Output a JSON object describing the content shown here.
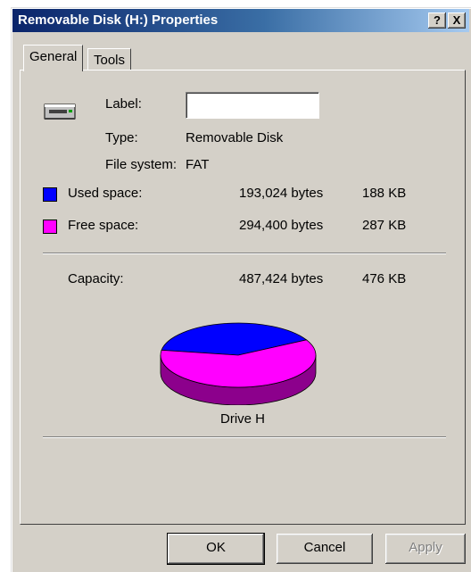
{
  "window": {
    "title": "Removable Disk (H:) Properties",
    "help_glyph": "?",
    "close_glyph": "X"
  },
  "tabs": [
    {
      "label": "General",
      "active": true
    },
    {
      "label": "Tools",
      "active": false
    }
  ],
  "general": {
    "drive_icon": "removable-drive-icon",
    "label_caption": "Label:",
    "label_value": "",
    "type_caption": "Type:",
    "type_value": "Removable Disk",
    "fs_caption": "File system:",
    "fs_value": "FAT",
    "used": {
      "caption": "Used space:",
      "bytes": "193,024 bytes",
      "size": "188 KB",
      "color": "#0000ff"
    },
    "free": {
      "caption": "Free space:",
      "bytes": "294,400 bytes",
      "size": "287 KB",
      "color": "#ff00ff"
    },
    "capacity": {
      "caption": "Capacity:",
      "bytes": "487,424 bytes",
      "size": "476 KB"
    },
    "drive_caption": "Drive H"
  },
  "chart_data": {
    "type": "pie",
    "slices": [
      {
        "label": "Used space",
        "value": 193024,
        "color": "#0000ff"
      },
      {
        "label": "Free space",
        "value": 294400,
        "color": "#ff00ff"
      }
    ]
  },
  "buttons": {
    "ok": "OK",
    "cancel": "Cancel",
    "apply": "Apply"
  }
}
